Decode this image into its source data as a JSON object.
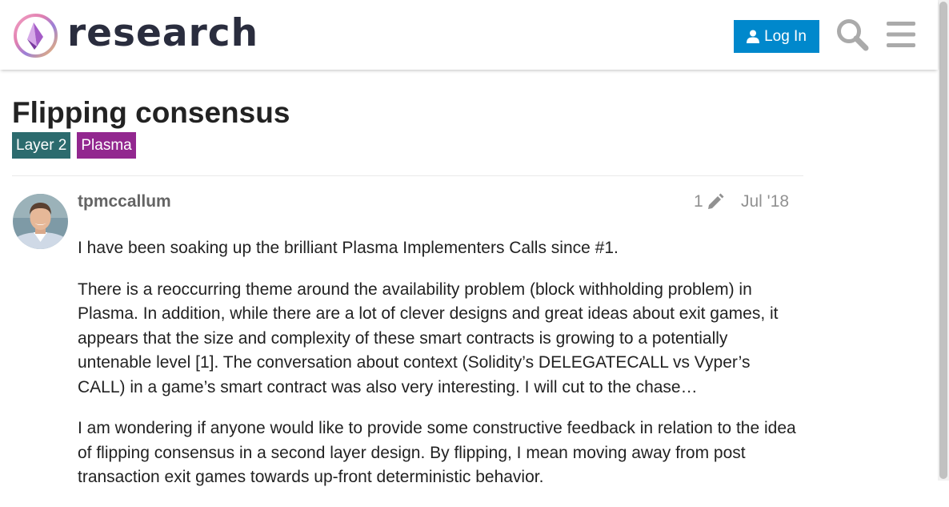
{
  "header": {
    "logo_text": "research",
    "login_label": "Log In",
    "icons": {
      "user": "user-icon",
      "search": "search-icon",
      "menu": "hamburger-menu-icon"
    },
    "accent_color": "#0088cc"
  },
  "topic": {
    "title": "Flipping consensus",
    "tags": [
      {
        "label": "Layer 2",
        "color": "#2c6b6e"
      },
      {
        "label": "Plasma",
        "color": "#92278f"
      }
    ]
  },
  "post": {
    "username": "tpmccallum",
    "edit_count": "1",
    "date": "Jul '18",
    "paragraphs": [
      "I have been soaking up the brilliant Plasma Implementers Calls since #1.",
      "There is a reoccurring theme around the availability problem (block withholding problem) in Plasma. In addition, while there are a lot of clever designs and great ideas about exit games, it appears that the size and complexity of these smart contracts is growing to a potentially untenable level [1]. The conversation about context (Solidity’s DELEGATECALL vs Vyper’s CALL) in a game’s smart contract was also very interesting. I will cut to the chase…",
      "I am wondering if anyone would like to provide some constructive feedback in relation to the idea of flipping consensus in a second layer design. By flipping, I mean moving away from post transaction exit games towards up-front deterministic behavior."
    ]
  }
}
